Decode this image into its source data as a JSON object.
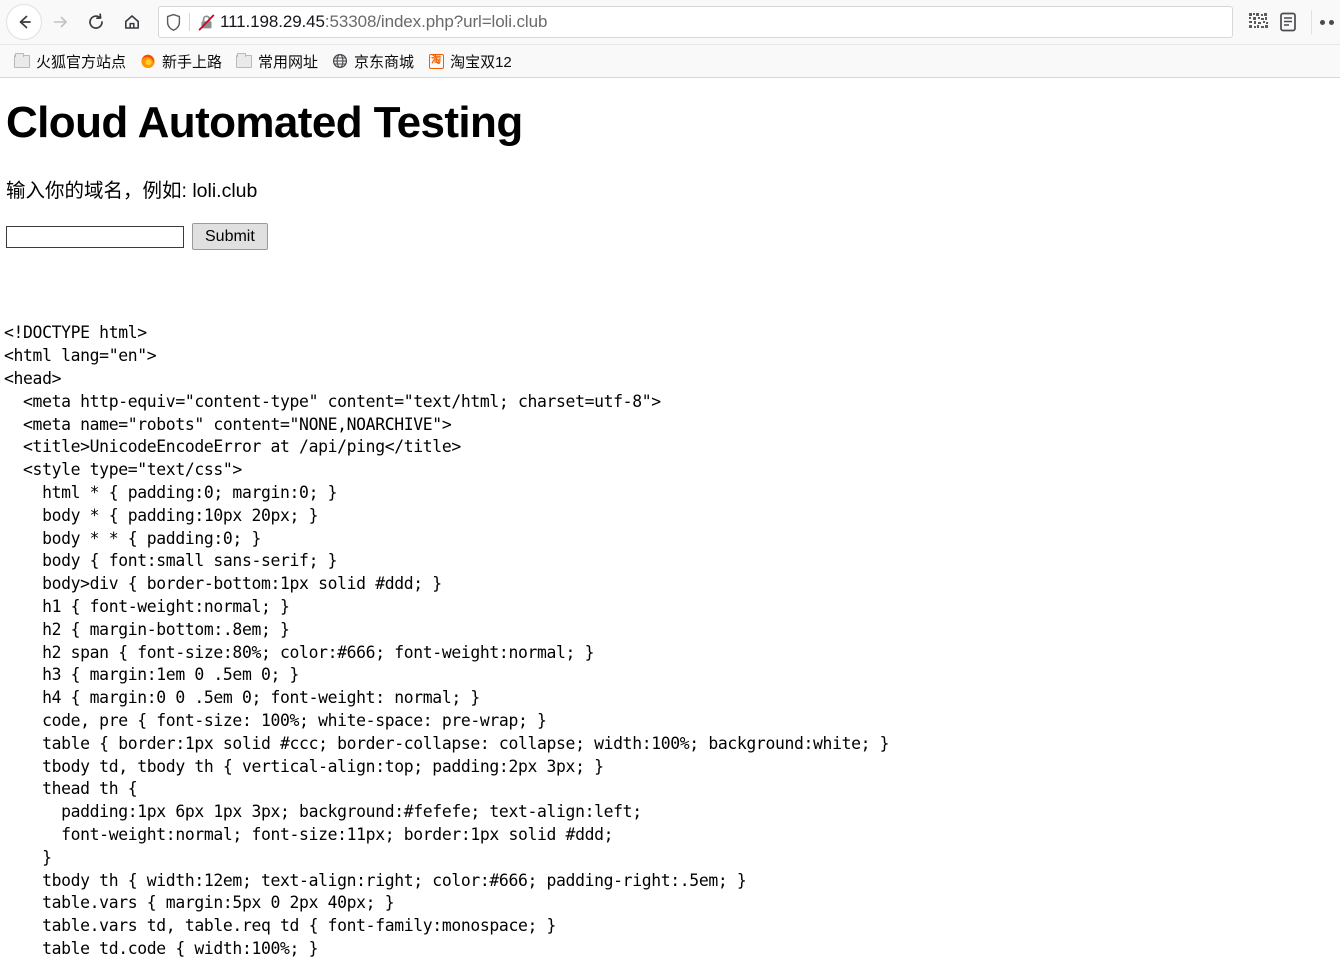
{
  "browser": {
    "nav": {
      "back_label": "Back",
      "forward_label": "Forward",
      "reload_label": "Reload",
      "home_label": "Home"
    },
    "urlbar": {
      "host": "111.198.29.45",
      "rest": ":53308/index.php?url=loli.club",
      "full_url": "111.198.29.45:53308/index.php?url=loli.club",
      "shield_icon": "shield-icon",
      "lock_icon": "lock-crossed-out-icon",
      "qr_icon": "qr-code-icon",
      "reader_icon": "reader-view-icon",
      "menu_icon": "more-menu-icon"
    },
    "bookmarks": [
      {
        "label": "火狐官方站点",
        "icon": "folder-icon"
      },
      {
        "label": "新手上路",
        "icon": "firefox-icon"
      },
      {
        "label": "常用网址",
        "icon": "folder-icon"
      },
      {
        "label": "京东商城",
        "icon": "globe-icon"
      },
      {
        "label": "淘宝双12",
        "icon": "taobao-icon"
      }
    ]
  },
  "page": {
    "title": "Cloud Automated Testing",
    "hint": "输入你的域名，例如: loli.club",
    "input_value": "",
    "input_placeholder": "",
    "submit_label": "Submit",
    "code_dump": "<!DOCTYPE html>\n<html lang=\"en\">\n<head>\n  <meta http-equiv=\"content-type\" content=\"text/html; charset=utf-8\">\n  <meta name=\"robots\" content=\"NONE,NOARCHIVE\">\n  <title>UnicodeEncodeError at /api/ping</title>\n  <style type=\"text/css\">\n    html * { padding:0; margin:0; }\n    body * { padding:10px 20px; }\n    body * * { padding:0; }\n    body { font:small sans-serif; }\n    body>div { border-bottom:1px solid #ddd; }\n    h1 { font-weight:normal; }\n    h2 { margin-bottom:.8em; }\n    h2 span { font-size:80%; color:#666; font-weight:normal; }\n    h3 { margin:1em 0 .5em 0; }\n    h4 { margin:0 0 .5em 0; font-weight: normal; }\n    code, pre { font-size: 100%; white-space: pre-wrap; }\n    table { border:1px solid #ccc; border-collapse: collapse; width:100%; background:white; }\n    tbody td, tbody th { vertical-align:top; padding:2px 3px; }\n    thead th {\n      padding:1px 6px 1px 3px; background:#fefefe; text-align:left;\n      font-weight:normal; font-size:11px; border:1px solid #ddd;\n    }\n    tbody th { width:12em; text-align:right; color:#666; padding-right:.5em; }\n    table.vars { margin:5px 0 2px 40px; }\n    table.vars td, table.req td { font-family:monospace; }\n    table td.code { width:100%; }"
  }
}
